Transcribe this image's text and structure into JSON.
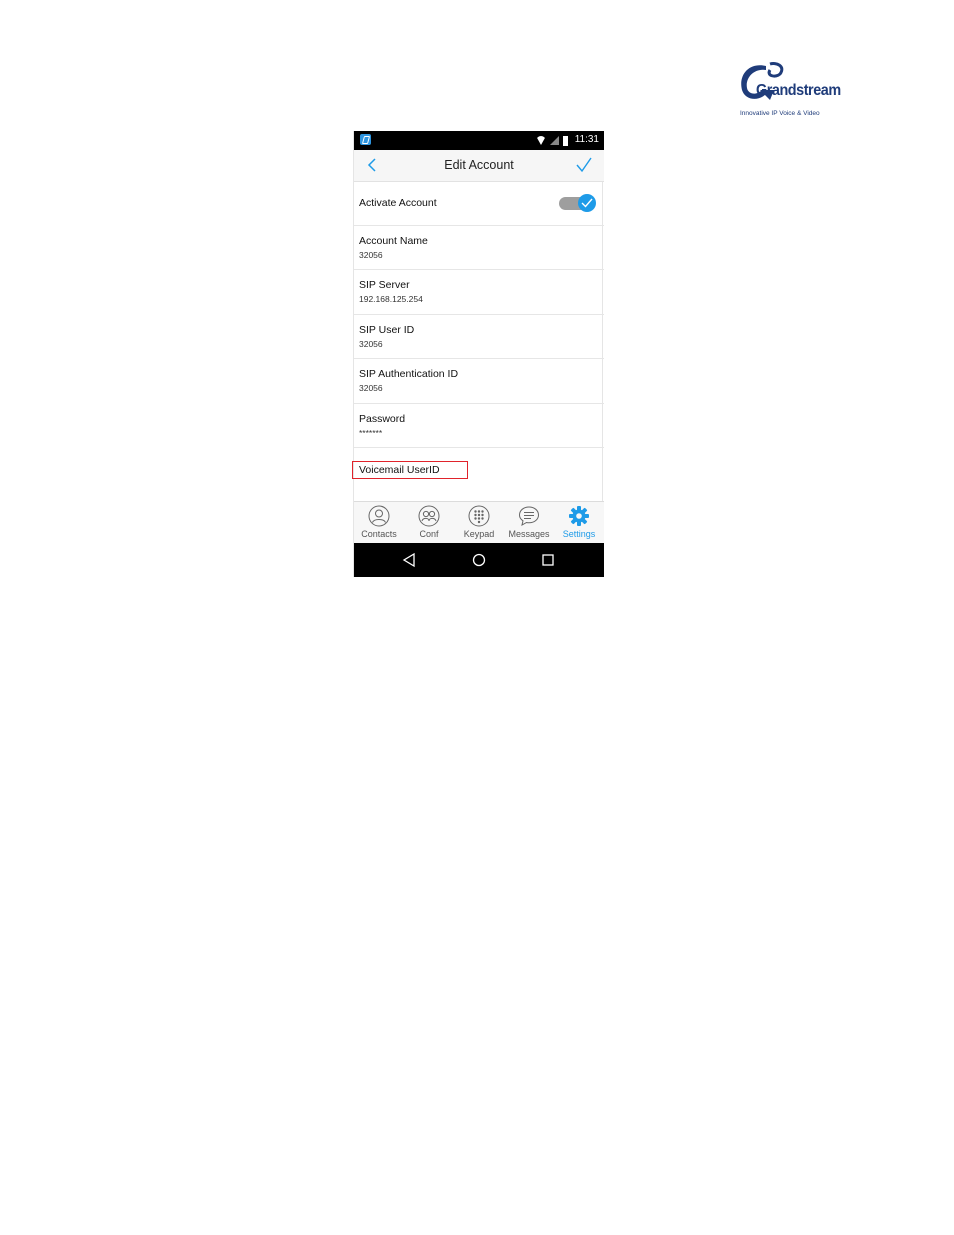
{
  "logo": {
    "wordmark": "Grandstream",
    "tagline": "Innovative IP Voice & Video"
  },
  "statusbar": {
    "time": "11:31"
  },
  "appbar": {
    "title": "Edit Account"
  },
  "rows": [
    {
      "label": "Activate Account",
      "toggle_on": true
    },
    {
      "label": "Account Name",
      "value": "32056"
    },
    {
      "label": "SIP Server",
      "value": "192.168.125.254"
    },
    {
      "label": "SIP User ID",
      "value": "32056"
    },
    {
      "label": "SIP Authentication ID",
      "value": "32056"
    },
    {
      "label": "Password",
      "value": "*******"
    },
    {
      "label": "Voicemail UserID",
      "highlighted": true
    }
  ],
  "tabs": [
    {
      "label": "Contacts",
      "icon": "contacts-icon",
      "active": false
    },
    {
      "label": "Conf",
      "icon": "conf-icon",
      "active": false
    },
    {
      "label": "Keypad",
      "icon": "keypad-icon",
      "active": false
    },
    {
      "label": "Messages",
      "icon": "messages-icon",
      "active": false
    },
    {
      "label": "Settings",
      "icon": "settings-gear-icon",
      "active": true
    }
  ],
  "colors": {
    "accent": "#1e9be8",
    "highlight_border": "#e0232b",
    "brand": "#1f3c7a"
  }
}
